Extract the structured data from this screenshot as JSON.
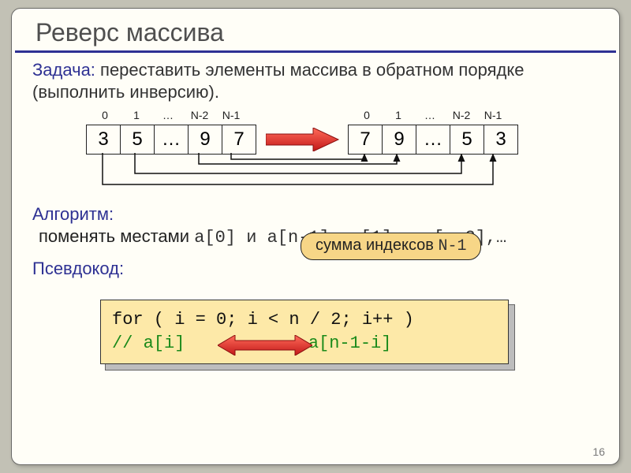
{
  "title": "Реверс массива",
  "task_label": "Задача:",
  "task_text": " переставить элементы массива в обратном порядке (выполнить инверсию).",
  "indices": [
    "0",
    "1",
    "…",
    "N-2",
    "N-1"
  ],
  "array_left": [
    "3",
    "5",
    "…",
    "9",
    "7"
  ],
  "array_right": [
    "7",
    "9",
    "…",
    "5",
    "3"
  ],
  "algo_label": "Алгоритм:",
  "swap_prefix": "поменять местами ",
  "swap_code": "a[0] и a[n-1], a[1] и a[n-2],…",
  "callout_text": "сумма индексов ",
  "callout_code": "N-1",
  "pseudo_label": "Псевдокод:",
  "code_line1": "for ( i = 0; i < n / 2; i++ )",
  "code_line2a": " // a[i]",
  "code_line2b": "a[n-1-i]",
  "page": "16"
}
